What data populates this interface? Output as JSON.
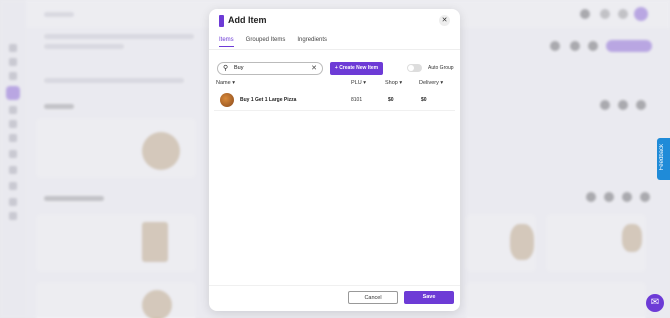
{
  "modal": {
    "title": "Add Item",
    "close_icon": "close-icon",
    "tabs": [
      {
        "label": "Items",
        "active": true
      },
      {
        "label": "Grouped Items",
        "active": false
      },
      {
        "label": "Ingredients",
        "active": false
      }
    ],
    "search": {
      "value": "Buy",
      "icon": "search-icon",
      "clear_icon": "clear-icon"
    },
    "create_button": "+ Create New Item",
    "auto_group_label": "Auto Group",
    "auto_group_on": false,
    "columns": [
      "Name",
      "PLU",
      "Shop",
      "Delivery"
    ],
    "rows": [
      {
        "name": "Buy 1 Get 1 Large Pizza",
        "plu": "8101",
        "shop": "$0",
        "delivery": "$0"
      }
    ],
    "cancel_label": "Cancel",
    "save_label": "Save"
  },
  "feedback_label": "Feedback",
  "accent_color": "#6d3bd6",
  "annotation_color": "#c0392b"
}
